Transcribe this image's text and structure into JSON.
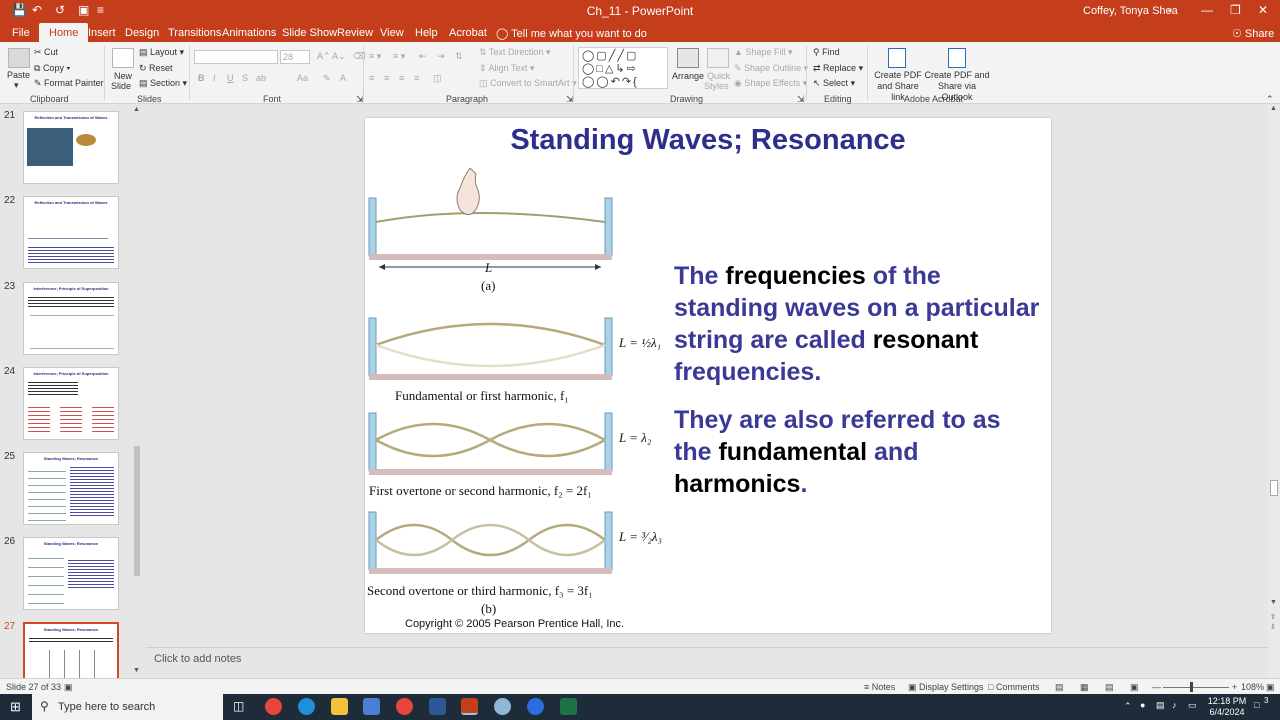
{
  "title_bar": {
    "document_title": "Ch_11  -  PowerPoint",
    "user": "Coffey, Tonya Shea",
    "icons": [
      "save-icon",
      "undo-icon",
      "redo-icon",
      "slideshow-start-icon",
      "customize-icon",
      "ribbon-display-icon",
      "minimize-icon",
      "restore-icon",
      "close-icon"
    ]
  },
  "menu": {
    "tabs": [
      "File",
      "Home",
      "Insert",
      "Design",
      "Transitions",
      "Animations",
      "Slide Show",
      "Review",
      "View",
      "Help",
      "Acrobat"
    ],
    "active_tab": "Home",
    "tell_me": "Tell me what you want to do",
    "share": "Share"
  },
  "ribbon": {
    "clipboard": {
      "paste": "Paste",
      "cut": "Cut",
      "copy": "Copy",
      "format_painter": "Format Painter",
      "label": "Clipboard"
    },
    "slides": {
      "new_slide": "New",
      "new_slide2": "Slide",
      "layout": "Layout",
      "reset": "Reset",
      "section": "Section",
      "label": "Slides"
    },
    "font": {
      "size": "28",
      "label": "Font",
      "bold": "B",
      "italic": "I",
      "underline": "U",
      "strike": "S",
      "shadow": "ab",
      "case": "Aa"
    },
    "paragraph": {
      "text_direction": "Text Direction",
      "align_text": "Align Text",
      "convert": "Convert to SmartArt",
      "label": "Paragraph"
    },
    "drawing": {
      "arrange": "Arrange",
      "quick_styles": "Quick",
      "quick_styles2": "Styles",
      "shape_fill": "Shape Fill",
      "shape_outline": "Shape Outline",
      "shape_effects": "Shape Effects",
      "label": "Drawing"
    },
    "editing": {
      "find": "Find",
      "replace": "Replace",
      "select": "Select",
      "label": "Editing"
    },
    "acrobat": {
      "create_share_link": "Create PDF and Share link",
      "create_outlook": "Create PDF and Share via Outlook",
      "label": "Adobe Acrobat"
    }
  },
  "thumbnails": [
    {
      "num": "21",
      "title": "Reflection and Transmission of Waves"
    },
    {
      "num": "22",
      "title": "Reflection and Transmission of Waves"
    },
    {
      "num": "23",
      "title": "Interference; Principle of Superposition"
    },
    {
      "num": "24",
      "title": "Interference; Principle of Superposition"
    },
    {
      "num": "25",
      "title": "Standing Waves; Resonance"
    },
    {
      "num": "26",
      "title": "Standing Waves; Resonance"
    },
    {
      "num": "27",
      "title": "Standing Waves; Resonance",
      "selected": true
    }
  ],
  "slide": {
    "title": "Standing Waves; Resonance",
    "para1": [
      "The ",
      "frequencies",
      " of the standing waves on a particular string are called ",
      "resonant",
      " frequencies",
      "."
    ],
    "para2": [
      "They are also referred to as the ",
      "fundamental",
      " and ",
      "harmonics",
      "."
    ],
    "figure": {
      "length_label": "L",
      "part_a": "(a)",
      "part_b": "(b)",
      "eq1": "L = ½λ₁",
      "eq2": "L = λ₂",
      "eq3": "L = ³⁄₂λ₃",
      "cap1": "Fundamental or first harmonic, f₁",
      "cap2": "First overtone or second harmonic, f₂ = 2f₁",
      "cap3": "Second overtone or third harmonic, f₃ = 3f₁"
    },
    "copyright": "Copyright © 2005 Pearson Prentice Hall, Inc."
  },
  "notes_placeholder": "Click to add notes",
  "status_bar": {
    "slide_info": "Slide 27 of 33",
    "notes": "Notes",
    "display_settings": "Display Settings",
    "comments": "Comments",
    "zoom": "108%"
  },
  "taskbar": {
    "search_placeholder": "Type here to search",
    "time": "12:18 PM",
    "date": "6/4/2024",
    "notifications": "3"
  },
  "colors": {
    "accent": "#c43e1c",
    "title_text": "#2e2e8c",
    "body_text": "#3a3a96",
    "taskbar": "#1e2b38"
  }
}
